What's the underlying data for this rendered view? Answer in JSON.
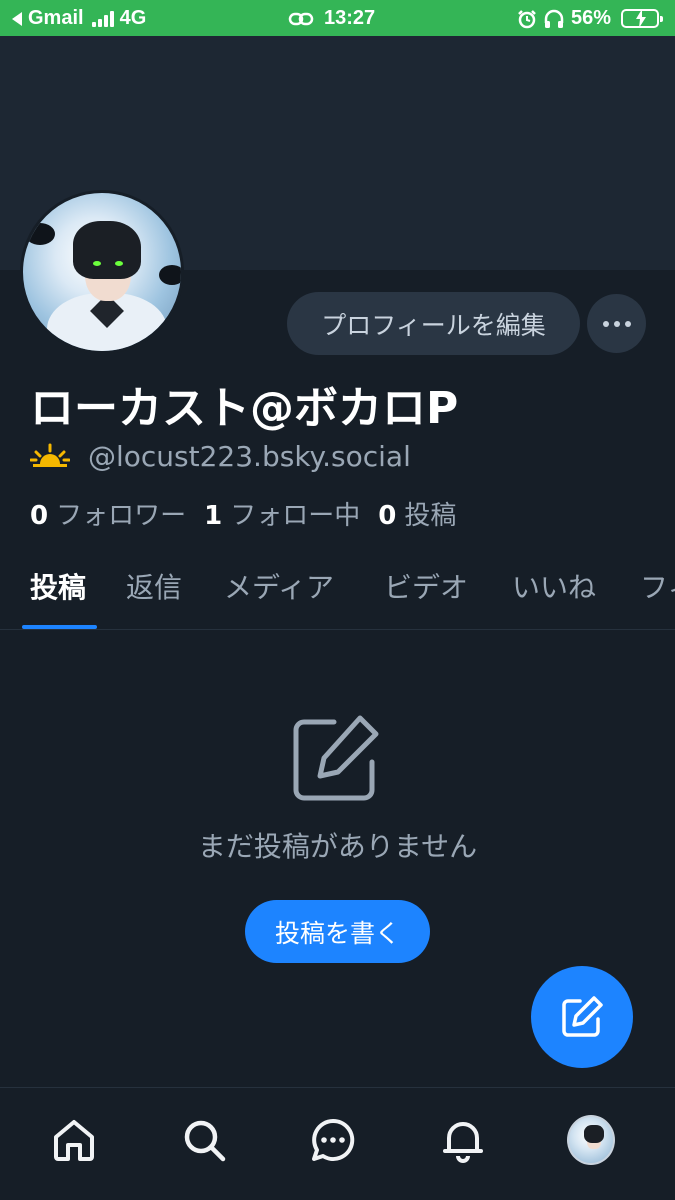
{
  "status_bar": {
    "back_app": "Gmail",
    "network": "4G",
    "time": "13:27",
    "battery": "56%"
  },
  "profile": {
    "edit_label": "プロフィールを編集",
    "display_name": "ローカスト@ボカロP",
    "handle": "@locust223.bsky.social",
    "stats": {
      "followers_count": "0",
      "followers_label": "フォロワー",
      "following_count": "1",
      "following_label": "フォロー中",
      "posts_count": "0",
      "posts_label": "投稿"
    }
  },
  "tabs": [
    {
      "label": "投稿",
      "active": true
    },
    {
      "label": "返信"
    },
    {
      "label": "メディア"
    },
    {
      "label": "ビデオ"
    },
    {
      "label": "いいね"
    },
    {
      "label": "フィード"
    }
  ],
  "empty_state": {
    "icon": "edit-icon",
    "message": "まだ投稿がありません",
    "button_label": "投稿を書く"
  },
  "bottom_nav": [
    "home-icon",
    "search-icon",
    "chat-icon",
    "bell-icon",
    "profile-avatar"
  ],
  "colors": {
    "accent": "#1d84ff",
    "background": "#161e27",
    "status_bar": "#34b556"
  }
}
